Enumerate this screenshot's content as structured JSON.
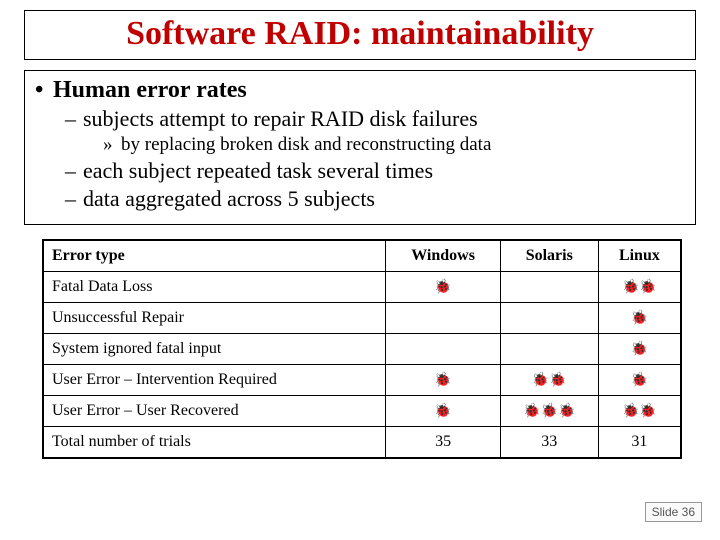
{
  "title": "Software RAID: maintainability",
  "bullets": {
    "b1": "Human error rates",
    "b2a": "subjects attempt to repair RAID disk failures",
    "b3a": "by replacing broken disk and reconstructing data",
    "b2b": "each subject repeated task several times",
    "b2c": "data aggregated across 5 subjects"
  },
  "columns": [
    "Error type",
    "Windows",
    "Solaris",
    "Linux"
  ],
  "rows": [
    {
      "label": "Fatal Data Loss",
      "windows": 1,
      "solaris": 0,
      "linux": 2
    },
    {
      "label": "Unsuccessful Repair",
      "windows": 0,
      "solaris": 0,
      "linux": 1
    },
    {
      "label": "System ignored fatal input",
      "windows": 0,
      "solaris": 0,
      "linux": 1
    },
    {
      "label": "User Error – Intervention Required",
      "windows": 1,
      "solaris": 2,
      "linux": 1
    },
    {
      "label": "User Error – User Recovered",
      "windows": 1,
      "solaris": 3,
      "linux": 2
    },
    {
      "label": "Total number of trials",
      "windows": "35",
      "solaris": "33",
      "linux": "31"
    }
  ],
  "bug_glyph": "🐞",
  "footer": "Slide 36",
  "chart_data": {
    "type": "table",
    "title": "Human error rates across OS",
    "columns": [
      "Error type",
      "Windows",
      "Solaris",
      "Linux"
    ],
    "rows": [
      [
        "Fatal Data Loss",
        1,
        0,
        2
      ],
      [
        "Unsuccessful Repair",
        0,
        0,
        1
      ],
      [
        "System ignored fatal input",
        0,
        0,
        1
      ],
      [
        "User Error – Intervention Required",
        1,
        2,
        1
      ],
      [
        "User Error – User Recovered",
        1,
        3,
        2
      ],
      [
        "Total number of trials",
        35,
        33,
        31
      ]
    ]
  }
}
